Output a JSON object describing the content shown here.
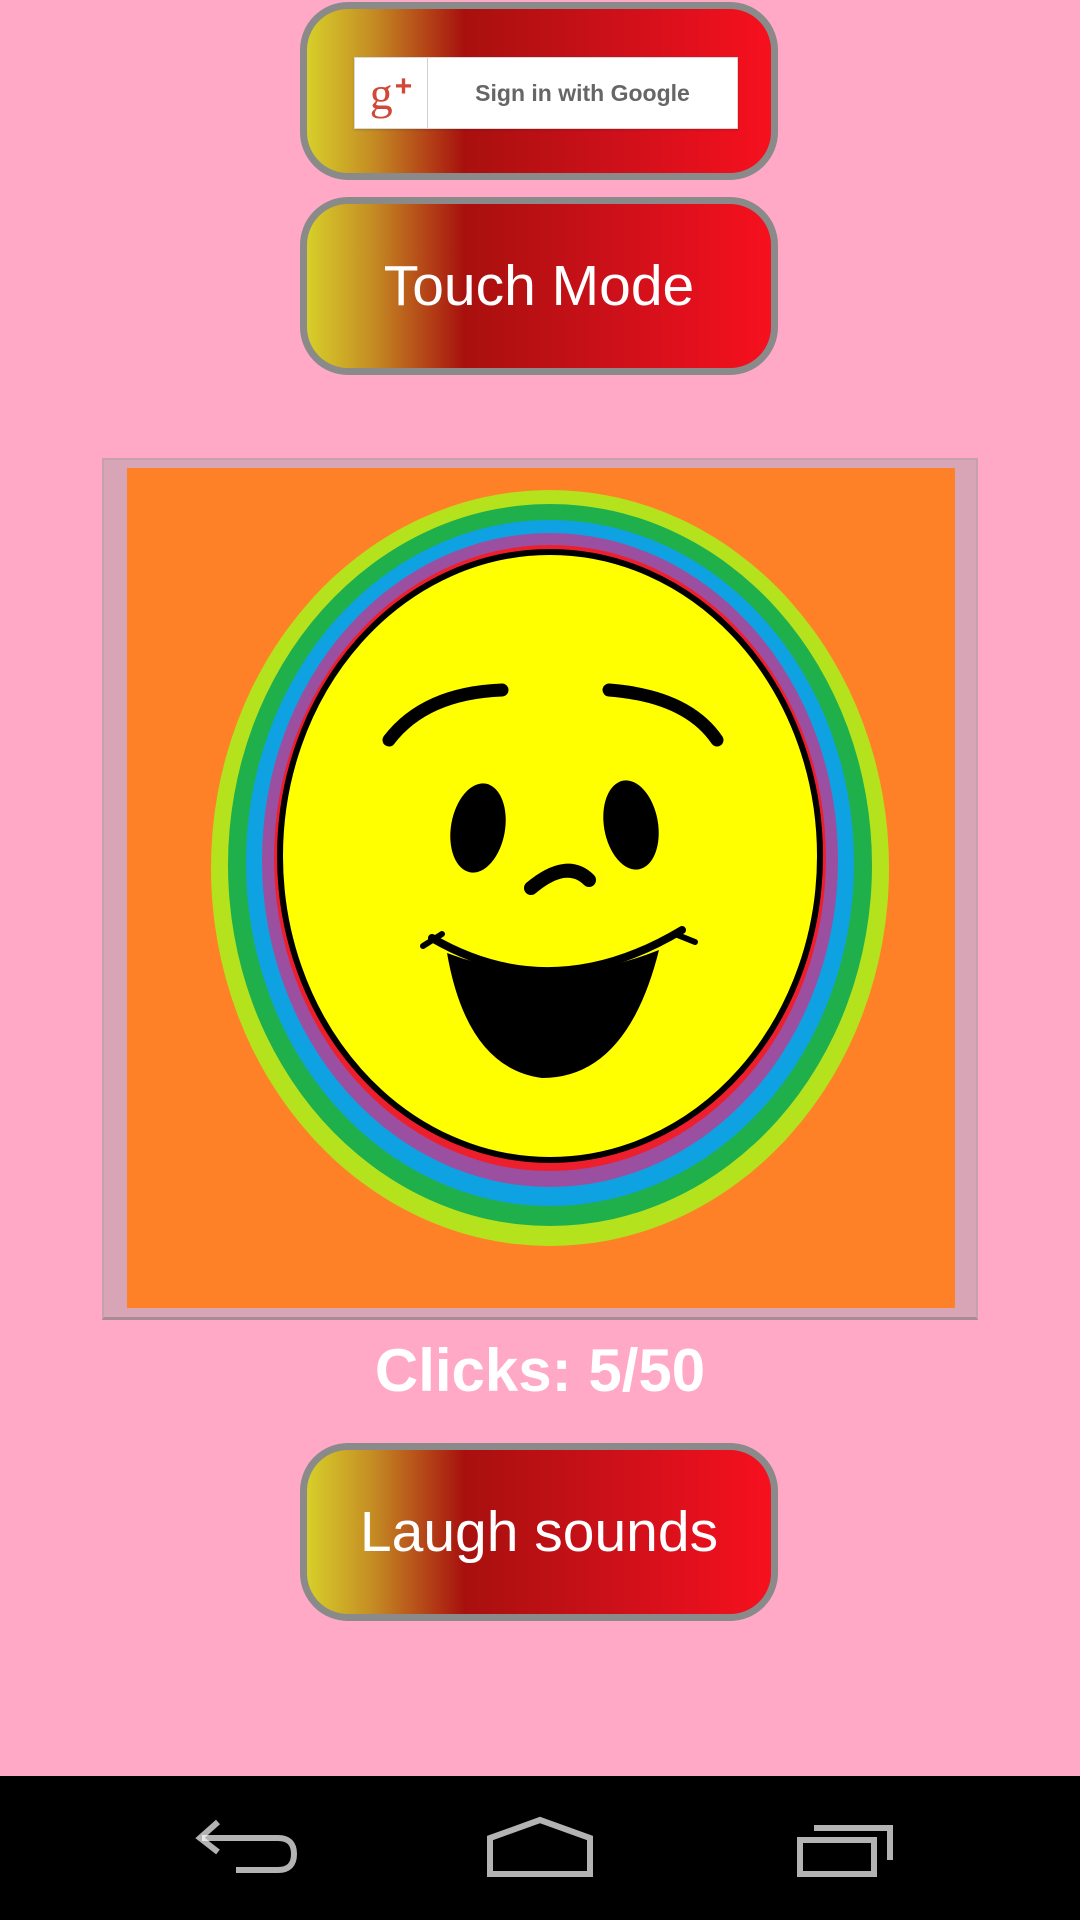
{
  "buttons": {
    "google_signin": "Sign in with Google",
    "google_plus_glyph": "g",
    "plus_glyph": "+",
    "touch_mode": "Touch Mode",
    "laugh_sounds": "Laugh sounds"
  },
  "status": {
    "clicks": "Clicks: 5/50"
  },
  "colors": {
    "background": "#ffa9c6",
    "button_gradient": [
      "#d7cf2a",
      "#a8100e",
      "#f7101e"
    ],
    "image_background": "#fe8127",
    "face": "#ffff00",
    "rings": [
      "#b4e31e",
      "#1fb04c",
      "#0ea2e2",
      "#9b4fa0",
      "#ee1f2d"
    ]
  },
  "navigation": {
    "back": "back-icon",
    "home": "home-icon",
    "recents": "recents-icon"
  }
}
